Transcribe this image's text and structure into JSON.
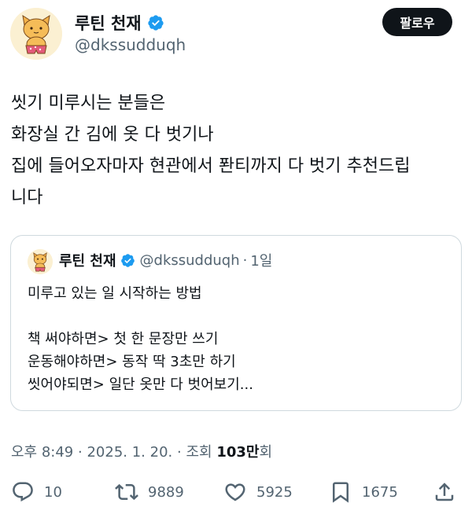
{
  "author": {
    "name": "루틴 천재",
    "handle": "@dkssudduqh",
    "follow_label": "팔로우"
  },
  "tweet": {
    "lines": [
      "씻기 미루시는 분들은",
      "화장실 간 김에 옷 다 벗기나",
      "집에 들어오자마자 현관에서 퐌티까지 다 벗기 추천드립",
      "니다"
    ]
  },
  "quote": {
    "name": "루틴 천재",
    "handle": "@dkssudduqh",
    "dot": "·",
    "time": "1일",
    "lines": [
      "미루고 있는 일 시작하는 방법",
      "",
      "책 써야하면> 첫 한 문장만 쓰기",
      "운동해야하면> 동작 딱 3초만 하기",
      "씻어야되면> 일단 옷만 다 벗어보기..."
    ]
  },
  "meta": {
    "time": "오후 8:49",
    "date": "2025. 1. 20.",
    "views_label": "조회",
    "views_number": "103만",
    "views_suffix": "회",
    "separator": "·"
  },
  "actions": {
    "replies": "10",
    "retweets": "9889",
    "likes": "5925",
    "bookmarks": "1675"
  },
  "colors": {
    "verified": "#1d9bf0",
    "text_primary": "#0f1419",
    "text_secondary": "#536471",
    "border": "#cfd9de"
  }
}
